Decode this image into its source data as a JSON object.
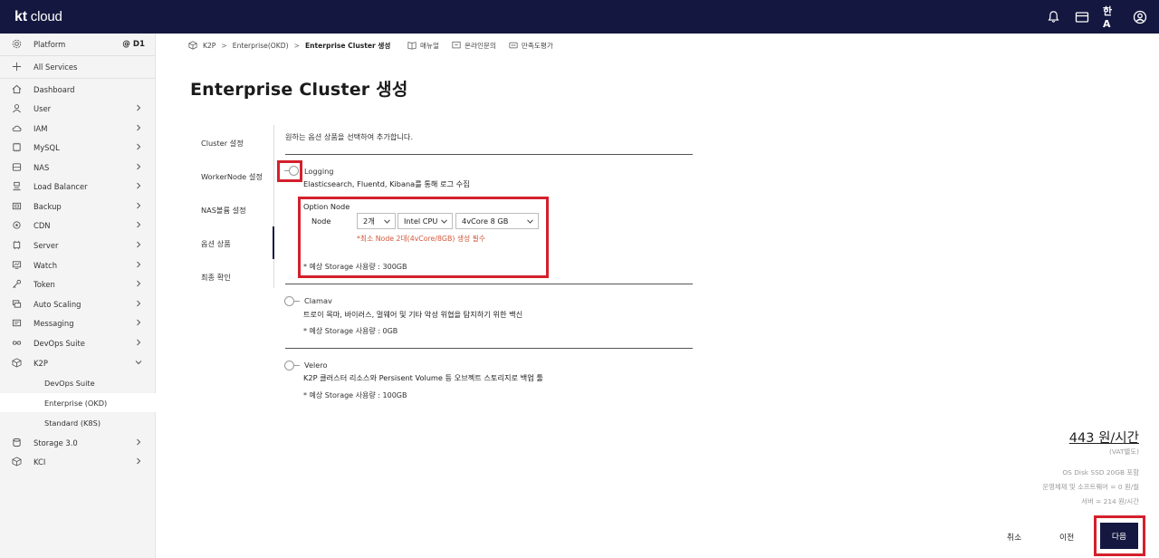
{
  "brand": {
    "logo_kt": "kt",
    "logo_cloud": "cloud"
  },
  "topbar": {
    "icons": [
      "bell-icon",
      "card-icon",
      "language-icon",
      "user-circle-icon"
    ],
    "lang_glyph": "한A"
  },
  "sidebar": {
    "platform": {
      "label": "Platform",
      "workspace": "@ D1"
    },
    "all_services": "All Services",
    "items": [
      {
        "label": "Dashboard",
        "icon": "home-icon"
      },
      {
        "label": "User",
        "icon": "user-icon"
      },
      {
        "label": "IAM",
        "icon": "cloud-icon"
      },
      {
        "label": "MySQL",
        "icon": "database-icon"
      },
      {
        "label": "NAS",
        "icon": "nas-icon"
      },
      {
        "label": "Load Balancer",
        "icon": "load-balancer-icon"
      },
      {
        "label": "Backup",
        "icon": "backup-icon"
      },
      {
        "label": "CDN",
        "icon": "cdn-icon"
      },
      {
        "label": "Server",
        "icon": "server-icon"
      },
      {
        "label": "Watch",
        "icon": "monitor-icon"
      },
      {
        "label": "Token",
        "icon": "key-icon"
      },
      {
        "label": "Auto Scaling",
        "icon": "auto-scaling-icon"
      },
      {
        "label": "Messaging",
        "icon": "message-icon"
      },
      {
        "label": "DevOps Suite",
        "icon": "infinity-icon"
      },
      {
        "label": "K2P",
        "icon": "cube-icon"
      }
    ],
    "k2p_sub": [
      "DevOps Suite",
      "Enterprise (OKD)",
      "Standard (K8S)"
    ],
    "after_items": [
      {
        "label": "Storage 3.0",
        "icon": "storage-icon"
      },
      {
        "label": "KCI",
        "icon": "cube-outline-icon"
      }
    ]
  },
  "breadcrumb": {
    "root": "K2P",
    "parent": "Enterprise(OKD)",
    "current": "Enterprise Cluster 생성",
    "sep": ">"
  },
  "toollinks": {
    "manual": "매뉴얼",
    "inquiry": "온라인문의",
    "survey": "만족도평가"
  },
  "page": {
    "title": "Enterprise Cluster 생성"
  },
  "steps": [
    "Cluster 설정",
    "WorkerNode 설정",
    "NAS볼륨 설정",
    "옵션 상품",
    "최종 확인"
  ],
  "options": {
    "intro": "원하는 옵션 상품을 선택하여 추가합니다.",
    "logging": {
      "title": "Logging",
      "desc": "Elasticsearch, Fluentd, Kibana를 통해 로그 수집",
      "option_node_label": "Option Node",
      "node_label": "Node",
      "count": "2개",
      "cpu": "Intel CPU",
      "spec": "4vCore 8 GB",
      "warning": "*최소 Node 2대(4vCore/8GB) 생성 필수",
      "storage": "* 예상 Storage 사용량 : 300GB"
    },
    "clamav": {
      "title": "Clamav",
      "desc": "트로이 목마, 바이러스, 멀웨어 및 기타 악성 위협을 탐지하기 위한 백신",
      "storage": "* 예상 Storage 사용량 : 0GB"
    },
    "velero": {
      "title": "Velero",
      "desc": "K2P 클러스터 리소스와 Persisent Volume 등 오브젝트 스토리지로 백업 툴",
      "storage": "* 예상 Storage 사용량 : 100GB"
    }
  },
  "price": {
    "amount": "443 원/시간",
    "vat": "(VAT별도)",
    "disk": "OS Disk SSD 20GB 포함",
    "os_sw": "운영체제 및 소프트웨어 = 0 원/월",
    "server": "서버 = 214 원/시간"
  },
  "buttons": {
    "cancel": "취소",
    "prev": "이전",
    "next": "다음"
  }
}
